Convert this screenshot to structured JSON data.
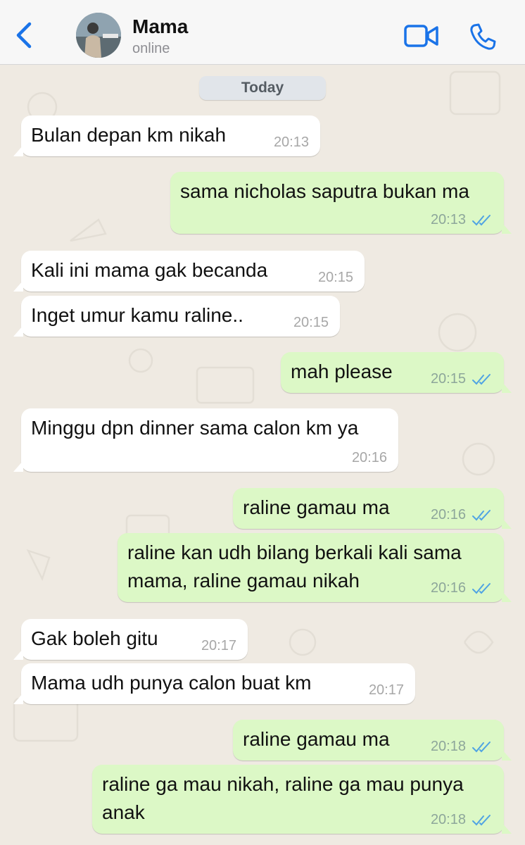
{
  "header": {
    "back_icon": "chevron-left-icon",
    "contact_name": "Mama",
    "status": "online",
    "video_icon": "video-camera-icon",
    "call_icon": "phone-icon",
    "accent": "#1a73e8"
  },
  "chat": {
    "date_label": "Today",
    "messages": [
      {
        "dir": "in",
        "text": "Bulan depan km nikah",
        "time": "20:13"
      },
      {
        "dir": "out",
        "text": "sama nicholas saputra bukan ma",
        "time": "20:13",
        "read": true
      },
      {
        "dir": "in",
        "text": "Kali ini mama gak becanda",
        "time": "20:15"
      },
      {
        "dir": "in",
        "text": "Inget umur kamu raline..",
        "time": "20:15"
      },
      {
        "dir": "out",
        "text": "mah please",
        "time": "20:15",
        "read": true
      },
      {
        "dir": "in",
        "text": "Minggu dpn dinner sama calon km ya",
        "time": "20:16"
      },
      {
        "dir": "out",
        "text": "raline gamau ma",
        "time": "20:16",
        "read": true
      },
      {
        "dir": "out",
        "text_line1": "raline kan udh bilang berkali kali sama",
        "text_line2": "mama, raline gamau nikah",
        "time": "20:16",
        "read": true
      },
      {
        "dir": "in",
        "text": "Gak boleh gitu",
        "time": "20:17"
      },
      {
        "dir": "in",
        "text": "Mama udh punya calon buat km",
        "time": "20:17"
      },
      {
        "dir": "out",
        "text": "raline gamau ma",
        "time": "20:18",
        "read": true
      },
      {
        "dir": "out",
        "text_line1": "raline ga mau nikah, raline ga mau punya",
        "text_line2": "anak",
        "time": "20:18",
        "read": true
      }
    ]
  },
  "colors": {
    "background": "#efeae2",
    "incoming_bubble": "#ffffff",
    "outgoing_bubble": "#dcf8c6",
    "read_tick": "#4fa3e3"
  }
}
